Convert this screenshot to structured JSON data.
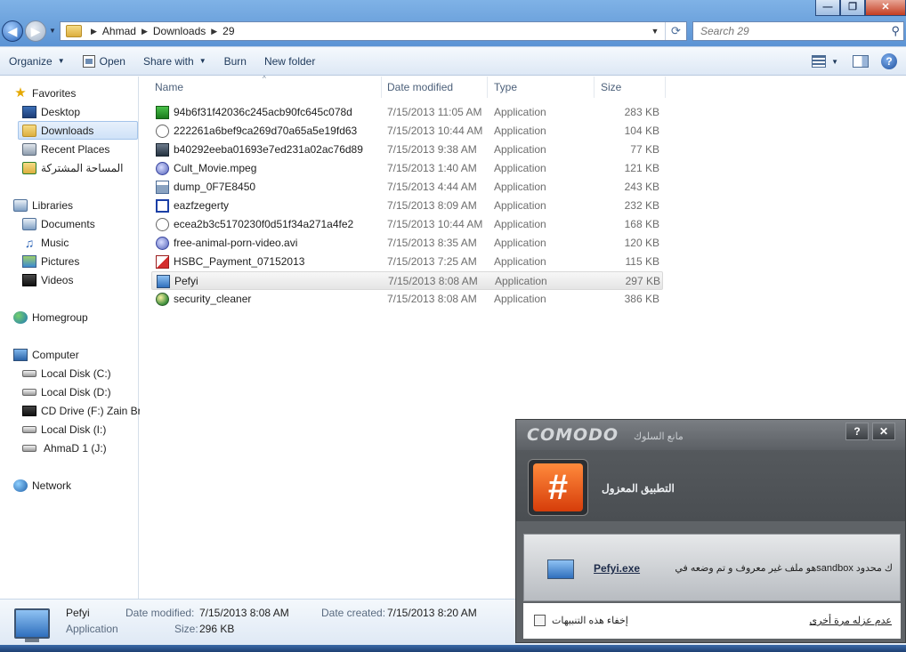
{
  "window": {
    "minimize": "—",
    "maximize": "❐",
    "close": "✕"
  },
  "address": {
    "crumbs": [
      "Ahmad",
      "Downloads",
      "29"
    ]
  },
  "search": {
    "placeholder": "Search 29"
  },
  "toolbar": {
    "organize": "Organize",
    "open": "Open",
    "share_with": "Share with",
    "burn": "Burn",
    "new_folder": "New folder"
  },
  "nav": {
    "favorites": "Favorites",
    "desktop": "Desktop",
    "downloads": "Downloads",
    "recent_places": "Recent Places",
    "shared_arabic": "المساحة المشتركة",
    "libraries": "Libraries",
    "documents": "Documents",
    "music": "Music",
    "pictures": "Pictures",
    "videos": "Videos",
    "homegroup": "Homegroup",
    "computer": "Computer",
    "disk_c": "Local Disk (C:)",
    "disk_d": "Local Disk (D:)",
    "cd_f": "CD Drive (F:) Zain Br",
    "disk_i": "Local Disk (I:)",
    "disk_j": "AhmaD 1 (J:)",
    "network": "Network"
  },
  "columns": {
    "name": "Name",
    "date": "Date modified",
    "type": "Type",
    "size": "Size"
  },
  "files": [
    {
      "name": "94b6f31f42036c245acb90fc645c078d",
      "date": "7/15/2013 11:05 AM",
      "type": "Application",
      "size": "283 KB",
      "icon": "green-app-icon"
    },
    {
      "name": "222261a6bef9ca269d70a65a5e19fd63",
      "date": "7/15/2013 10:44 AM",
      "type": "Application",
      "size": "104 KB",
      "icon": "hand-icon"
    },
    {
      "name": "b40292eeba01693e7ed231a02ac76d89",
      "date": "7/15/2013 9:38 AM",
      "type": "Application",
      "size": "77 KB",
      "icon": "image-app-icon"
    },
    {
      "name": "Cult_Movie.mpeg",
      "date": "7/15/2013 1:40 AM",
      "type": "Application",
      "size": "121 KB",
      "icon": "media-icon"
    },
    {
      "name": "dump_0F7E8450",
      "date": "7/15/2013 4:44 AM",
      "type": "Application",
      "size": "243 KB",
      "icon": "window-icon"
    },
    {
      "name": "eazfzegerty",
      "date": "7/15/2013 8:09 AM",
      "type": "Application",
      "size": "232 KB",
      "icon": "blue-frame-icon"
    },
    {
      "name": "ecea2b3c5170230f0d51f34a271a4fe2",
      "date": "7/15/2013 10:44 AM",
      "type": "Application",
      "size": "168 KB",
      "icon": "hand-icon"
    },
    {
      "name": "free-animal-porn-video.avi",
      "date": "7/15/2013 8:35 AM",
      "type": "Application",
      "size": "120 KB",
      "icon": "media-icon"
    },
    {
      "name": "HSBC_Payment_07152013",
      "date": "7/15/2013 7:25 AM",
      "type": "Application",
      "size": "115 KB",
      "icon": "pdf-icon"
    },
    {
      "name": "Pefyi",
      "date": "7/15/2013 8:08 AM",
      "type": "Application",
      "size": "297 KB",
      "icon": "monitor-icon"
    },
    {
      "name": "security_cleaner",
      "date": "7/15/2013 8:08 AM",
      "type": "Application",
      "size": "386 KB",
      "icon": "globe-icon"
    }
  ],
  "details": {
    "name": "Pefyi",
    "kind": "Application",
    "modified_label": "Date modified:",
    "modified_value": "7/15/2013 8:08 AM",
    "created_label": "Date created:",
    "created_value": "7/15/2013 8:20 AM",
    "size_label": "Size:",
    "size_value": "296 KB"
  },
  "comodo": {
    "logo": "COMODO",
    "subtitle": "مانع السلوك",
    "help": "?",
    "close": "✕",
    "badge_symbol": "#",
    "title": "التطبيق المعزول",
    "file_link": "Pefyi.exe",
    "message": "ك محدود sandboxهو ملف غير معروف و تم وضعه في",
    "hide_label": "إخفاء هذه التنبيهات",
    "footer_link": "عدم عزله مرة أخرى"
  }
}
